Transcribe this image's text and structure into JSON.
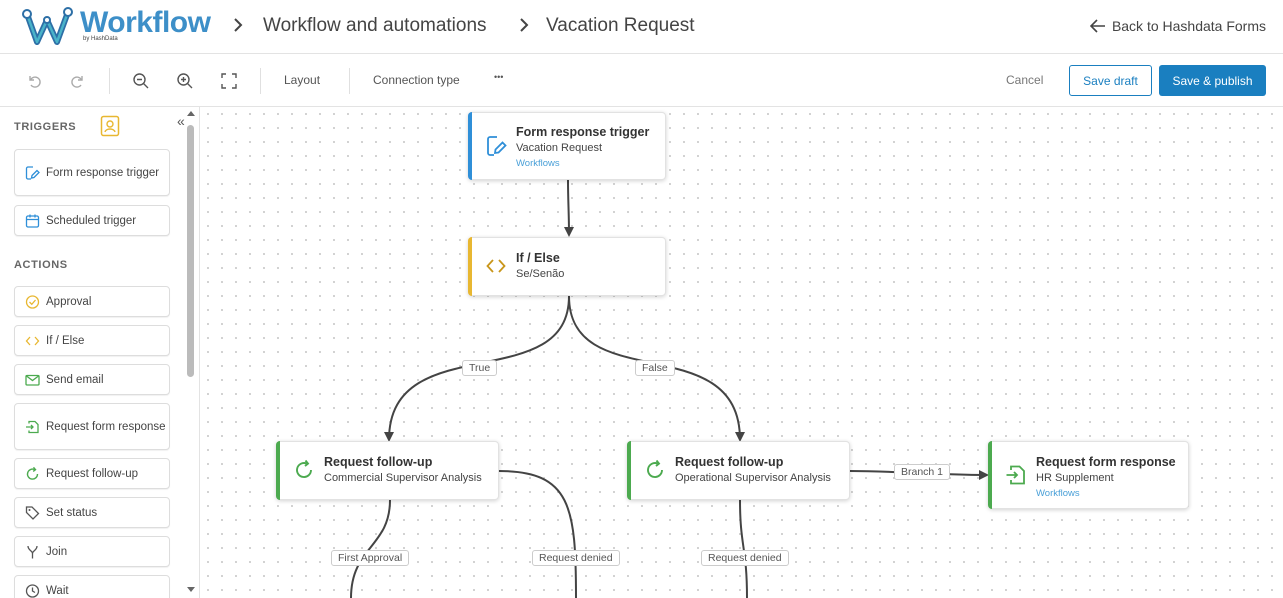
{
  "header": {
    "brand": "Workflow",
    "brand_sub": "by HashData",
    "breadcrumbs": [
      "Workflow and automations",
      "Vacation Request"
    ],
    "back_label": "Back to Hashdata Forms"
  },
  "toolbar": {
    "layout_label": "Layout",
    "connection_label": "Connection type",
    "more_label": "•••",
    "cancel_label": "Cancel",
    "save_draft_label": "Save draft",
    "save_publish_label": "Save & publish",
    "icons": [
      "undo-icon",
      "redo-icon",
      "zoom-out-icon",
      "zoom-in-icon",
      "fit-screen-icon"
    ]
  },
  "sidebar": {
    "triggers_heading": "TRIGGERS",
    "actions_heading": "ACTIONS",
    "collapse_label": "«",
    "triggers": [
      {
        "label": "Form response trigger",
        "icon": "form-edit-icon"
      },
      {
        "label": "Scheduled trigger",
        "icon": "calendar-icon"
      }
    ],
    "actions": [
      {
        "label": "Approval",
        "icon": "approval-check-icon"
      },
      {
        "label": "If / Else",
        "icon": "code-brackets-icon"
      },
      {
        "label": "Send email",
        "icon": "mail-icon"
      },
      {
        "label": "Request form response",
        "icon": "form-import-icon"
      },
      {
        "label": "Request follow-up",
        "icon": "refresh-icon"
      },
      {
        "label": "Set status",
        "icon": "tag-icon"
      },
      {
        "label": "Join",
        "icon": "merge-icon"
      },
      {
        "label": "Wait",
        "icon": "clock-icon"
      }
    ]
  },
  "canvas": {
    "nodes": [
      {
        "title": "Form response trigger",
        "subtitle": "Vacation Request",
        "link": "Workflows",
        "color": "#2f8fd8"
      },
      {
        "title": "If / Else",
        "subtitle": "Se/Senão",
        "color": "#e8b731"
      },
      {
        "title": "Request follow-up",
        "subtitle": "Commercial Supervisor Analysis",
        "color": "#4caa4f"
      },
      {
        "title": "Request follow-up",
        "subtitle": "Operational Supervisor Analysis",
        "color": "#4caa4f"
      },
      {
        "title": "Request form response",
        "subtitle": "HR Supplement",
        "link": "Workflows",
        "color": "#4caa4f"
      }
    ],
    "edge_labels": {
      "true": "True",
      "false": "False",
      "branch1": "Branch 1",
      "first_approval": "First Approval",
      "request_denied_1": "Request denied",
      "request_denied_2": "Request denied"
    }
  },
  "colors": {
    "accent": "#1a7fc0",
    "trigger": "#2f8fd8",
    "condition": "#e8b731",
    "action": "#4caa4f"
  }
}
